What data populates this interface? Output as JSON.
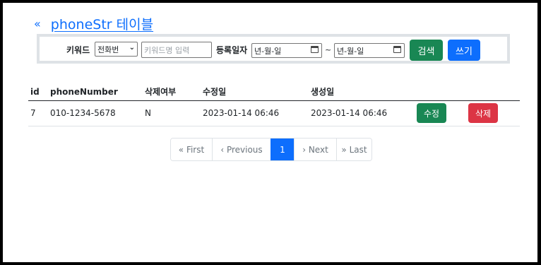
{
  "header": {
    "back_icon": "«",
    "title": "phoneStr 테이블"
  },
  "search": {
    "keyword_label": "키워드",
    "keyword_select_value": "전화번",
    "keyword_input_placeholder": "키워드명 입력",
    "date_label": "등록일자",
    "date_from_placeholder": "년-월-일",
    "date_separator": "~",
    "date_to_placeholder": "년-월-일",
    "search_button": "검색",
    "write_button": "쓰기"
  },
  "table": {
    "headers": [
      "id",
      "phoneNumber",
      "삭제여부",
      "수정일",
      "생성일"
    ],
    "rows": [
      {
        "id": "7",
        "phoneNumber": "010-1234-5678",
        "deleted": "N",
        "updated": "2023-01-14 06:46",
        "created": "2023-01-14 06:46",
        "edit_label": "수정",
        "delete_label": "삭제"
      }
    ]
  },
  "pagination": {
    "first": "« First",
    "previous": "‹ Previous",
    "current": "1",
    "next": "› Next",
    "last": "» Last"
  },
  "colors": {
    "primary": "#0d6efd",
    "success": "#198754",
    "danger": "#dc3545"
  }
}
